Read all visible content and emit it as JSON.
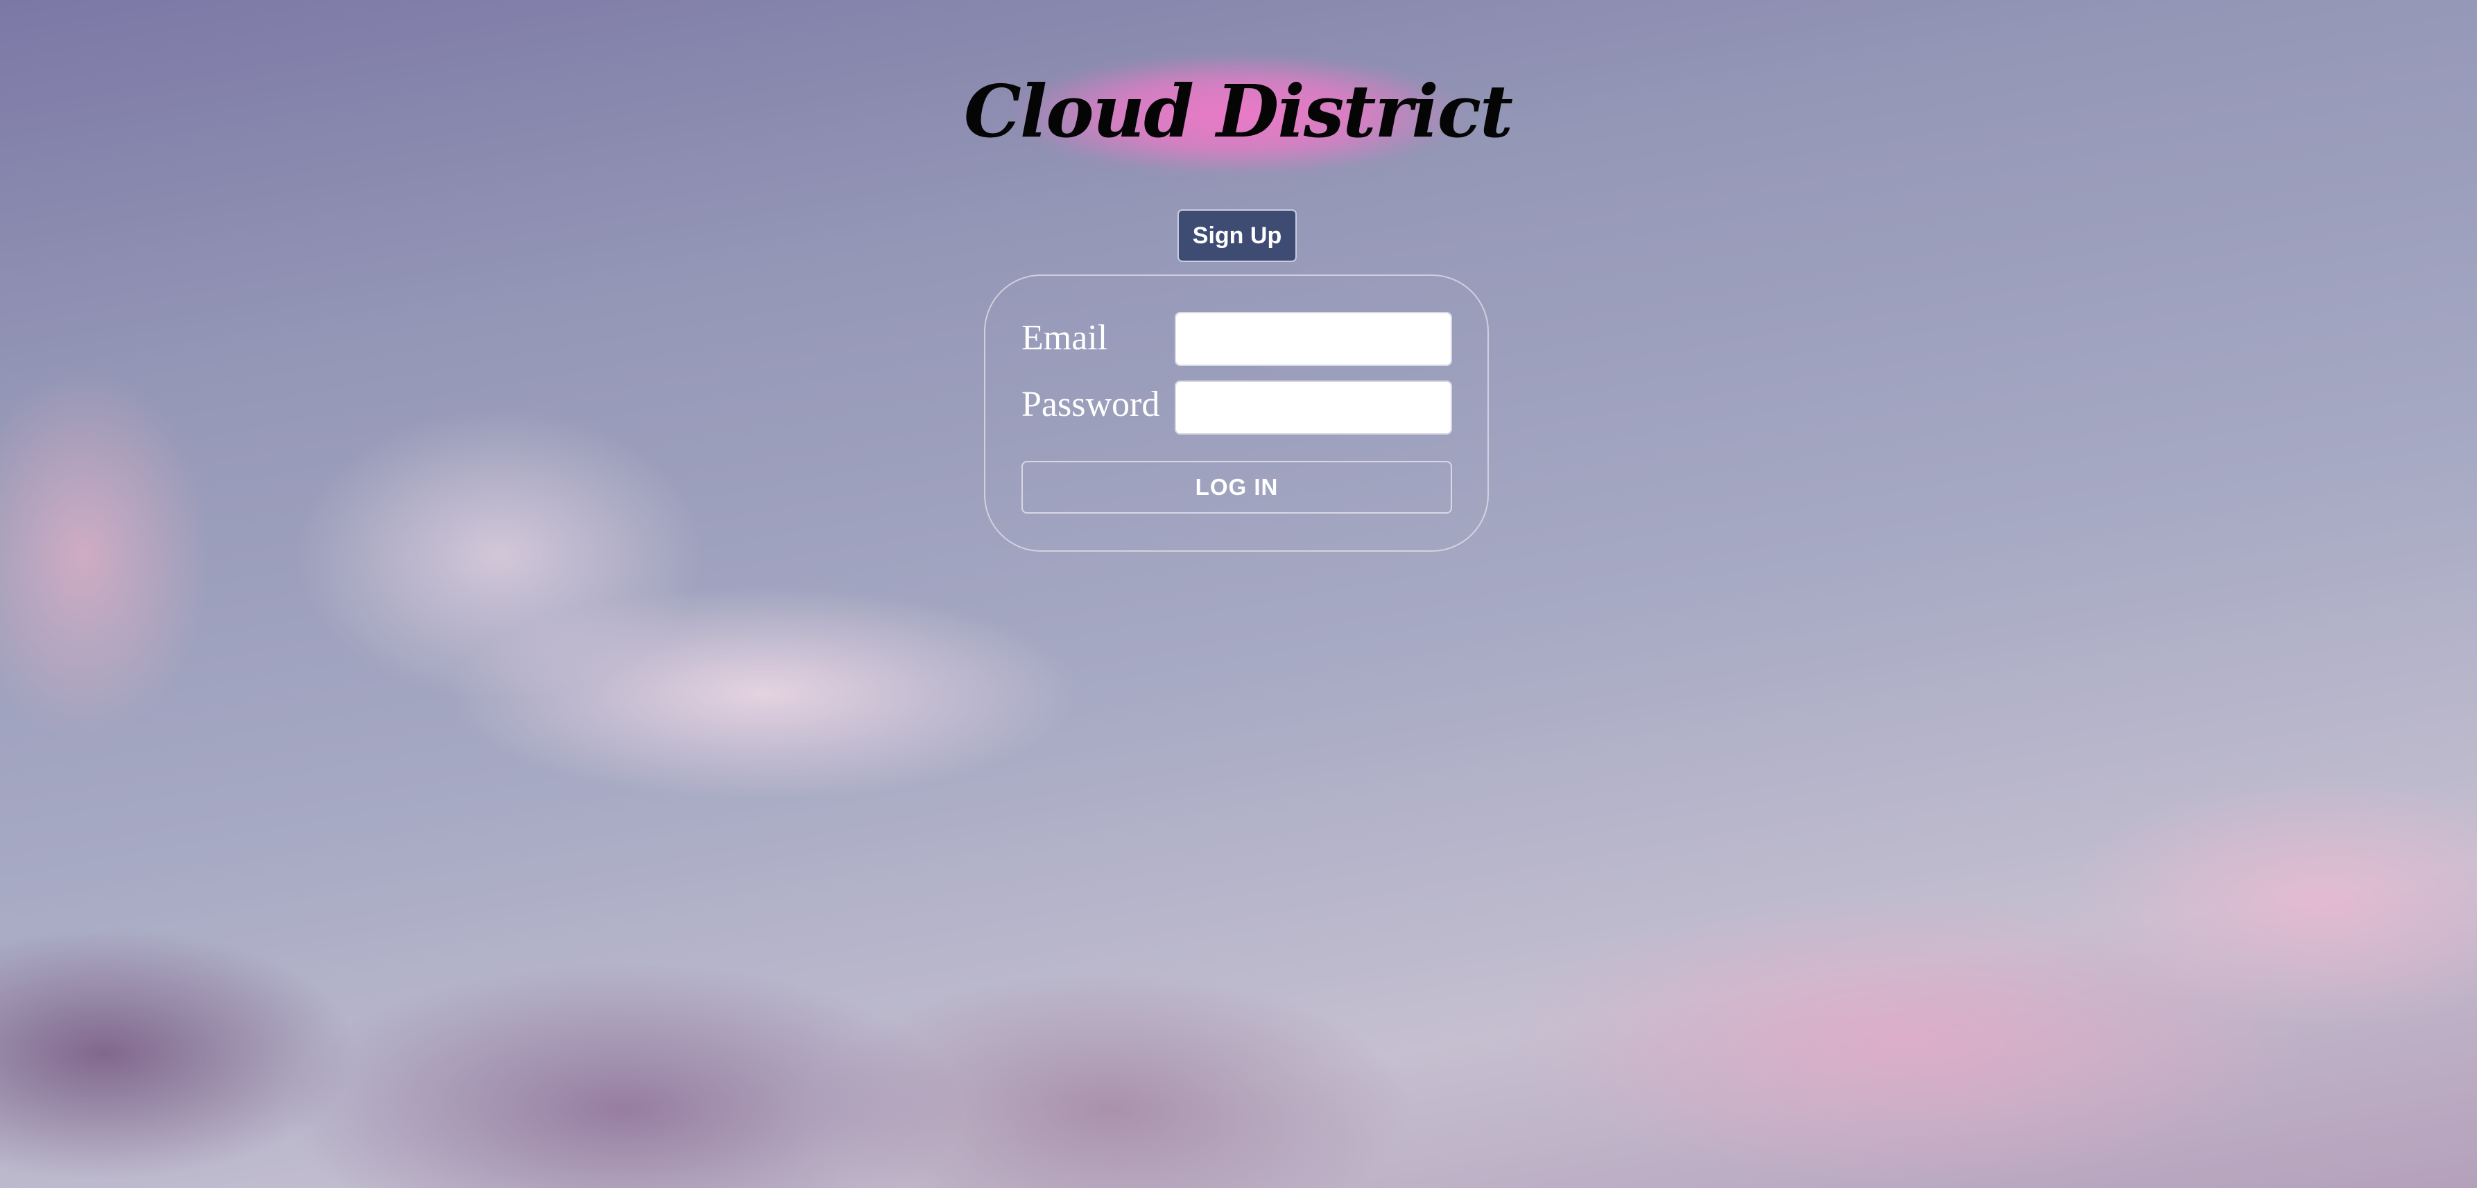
{
  "header": {
    "title": "Cloud District"
  },
  "actions": {
    "signup_label": "Sign Up"
  },
  "login_form": {
    "email_label": "Email",
    "email_value": "",
    "password_label": "Password",
    "password_value": "",
    "submit_label": "LOG IN"
  },
  "theme": {
    "signup_button_color": "#3e4c73",
    "title_glow_color": "#f078c8",
    "text_color": "#ffffff"
  }
}
